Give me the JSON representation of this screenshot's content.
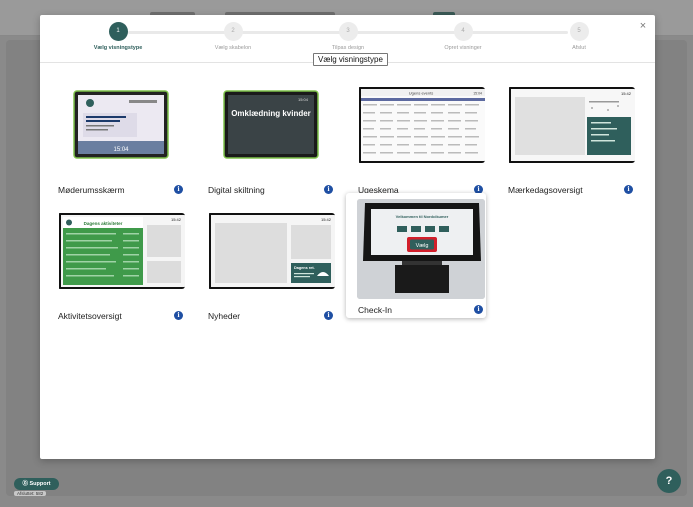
{
  "modal": {
    "close_label": "×",
    "tooltip": "Vælg visningstype",
    "steps": [
      {
        "number": "1",
        "label": "Vælg visningstype"
      },
      {
        "number": "2",
        "label": "Vælg skabelon"
      },
      {
        "number": "3",
        "label": "Tilpas design"
      },
      {
        "number": "4",
        "label": "Opret visninger"
      },
      {
        "number": "5",
        "label": "Afslut"
      }
    ],
    "active_step": 1,
    "types": [
      {
        "label": "Møderumsskærm"
      },
      {
        "label": "Digital skiltning"
      },
      {
        "label": "Ugeskema"
      },
      {
        "label": "Mærkedagsoversigt"
      },
      {
        "label": "Aktivitetsoversigt"
      },
      {
        "label": "Nyheder"
      },
      {
        "label": "Check-In"
      }
    ],
    "info_glyph": "i",
    "thumbs": {
      "digital_signage_text": "Omklædning kvinder",
      "digital_signage_time": "15:04",
      "meeting_time": "15:04",
      "activity_title": "Dagens aktiviteter",
      "activity_time": "15:42",
      "news_time": "15:42",
      "news_caption": "Dagens ret.",
      "birthday_time": "15:42",
      "weekly_title": "Ugens events",
      "weekly_time": "15:04",
      "checkin_title": "Velkommen til Nordcikumer",
      "checkin_button": "Vælg"
    }
  },
  "footer": {
    "support_label": "⓪ Support",
    "version": "Afsluttet: 582",
    "help_label": "?"
  },
  "colors": {
    "brand": "#2f5f5c",
    "info": "#1f4fa3",
    "highlight_red": "#d21f2b"
  }
}
